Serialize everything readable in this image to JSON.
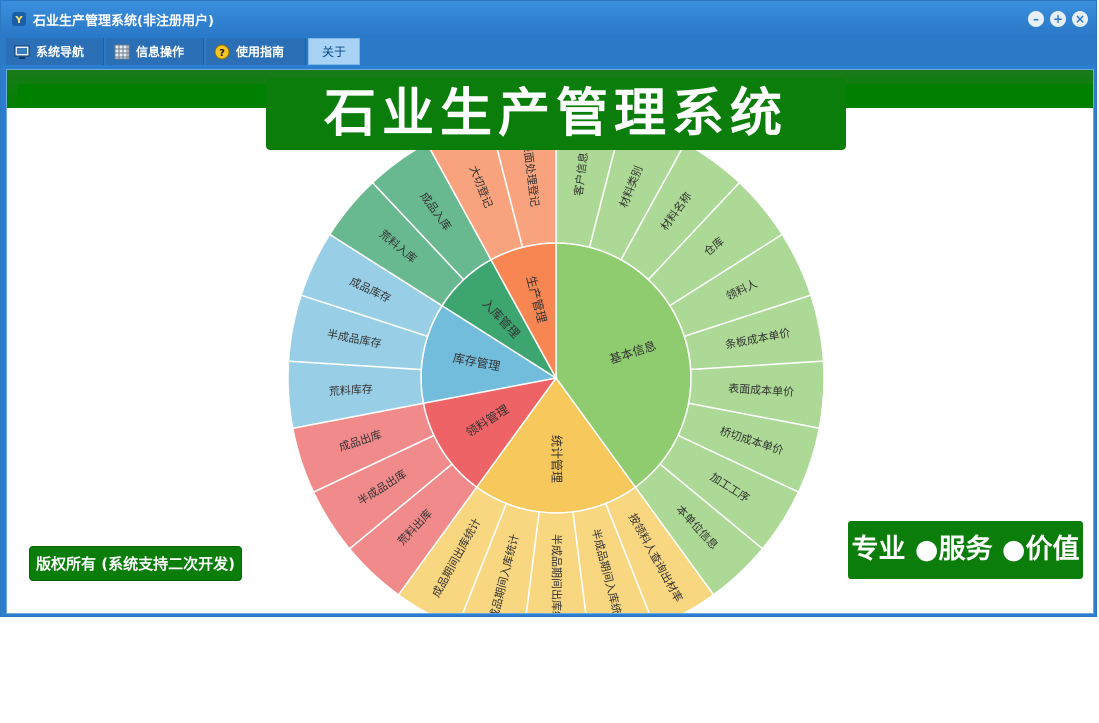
{
  "window": {
    "title": "石业生产管理系统(非注册用户)"
  },
  "menu": [
    {
      "label": "系统导航",
      "icon": "monitor-icon"
    },
    {
      "label": "信息操作",
      "icon": "grid-icon"
    },
    {
      "label": "使用指南",
      "icon": "help-icon"
    },
    {
      "label": "关于",
      "icon": ""
    }
  ],
  "banner": {
    "title": "石业生产管理系统"
  },
  "footer": {
    "copyright": "版权所有 (系统支持二次开发)",
    "slogan": "专业 ●服务 ●价值"
  },
  "colors": {
    "brand_green": "#0a7d0a",
    "titlebar_blue": "#2a78c8"
  },
  "sunburst": {
    "inner": [
      {
        "label": "基本信息",
        "color": "#8fcb6f",
        "children": [
          "客户信息",
          "材料类别",
          "材料名称",
          "仓库",
          "领料人",
          "条板成本单价",
          "表面成本单价",
          "桥切成本单价",
          "加工工序",
          "本单位信息"
        ]
      },
      {
        "label": "统计管理",
        "color": "#f7c95c",
        "children": [
          "按领料人查询出材率",
          "半成品期间入库统计",
          "半成品期间出库统计",
          "成品期间入库统计",
          "成品期间出库统计"
        ]
      },
      {
        "label": "领料管理",
        "color": "#ee6466",
        "children": [
          "荒料出库",
          "半成品出库",
          "成品出库"
        ]
      },
      {
        "label": "库存管理",
        "color": "#73bddc",
        "children": [
          "荒料库存",
          "半成品库存",
          "成品库存"
        ]
      },
      {
        "label": "入库管理",
        "color": "#3da56f",
        "children": [
          "荒料入库",
          "成品入库"
        ]
      },
      {
        "label": "生产管理",
        "color": "#f78653",
        "children": [
          "大切登记",
          "表面处理登记"
        ]
      }
    ],
    "outer_colors": {
      "基本信息": "#acd995",
      "统计管理": "#f9d680",
      "领料管理": "#f08a8b",
      "库存管理": "#98cfe7",
      "入库管理": "#68b890",
      "生产管理": "#f9a37e"
    }
  }
}
